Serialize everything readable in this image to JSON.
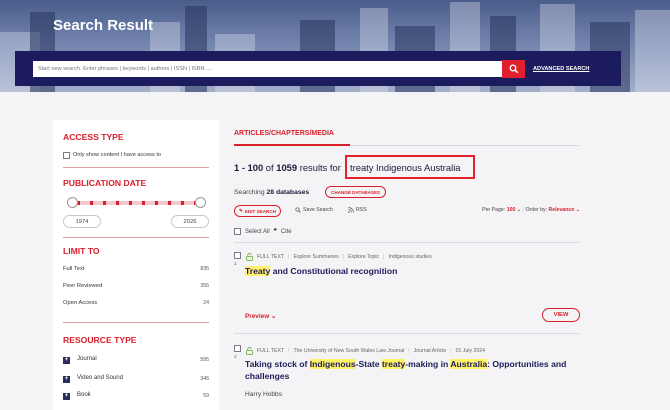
{
  "header": {
    "title": "Search Result",
    "search_placeholder": "Start new search. Enter phrases | keywords | authors | ISSN | ISBN ....",
    "advanced_search": "ADVANCED SEARCH"
  },
  "sidebar": {
    "access_type": {
      "title": "ACCESS TYPE",
      "checkbox_label": "Only show content I have access to"
    },
    "publication_date": {
      "title": "PUBLICATION DATE",
      "from_year": "1974",
      "to_year": "2026"
    },
    "limit_to": {
      "title": "LIMIT TO",
      "items": [
        {
          "label": "Full Text",
          "count": "835"
        },
        {
          "label": "Peer Reviewed",
          "count": "355"
        },
        {
          "label": "Open Access",
          "count": "24"
        }
      ]
    },
    "resource_type": {
      "title": "RESOURCE TYPE",
      "items": [
        {
          "label": "Journal",
          "count": "595"
        },
        {
          "label": "Video and Sound",
          "count": "346"
        },
        {
          "label": "Book",
          "count": "59"
        }
      ]
    }
  },
  "main": {
    "tab": "ARTICLES/CHAPTERS/MEDIA",
    "results_range": "1 - 100",
    "results_of": "of",
    "results_total": "1059",
    "results_for": "results for",
    "query": "treaty Indigenous Australia",
    "searching_label": "Searching",
    "databases_count": "28 databases",
    "change_databases": "CHANGE DATABASES",
    "edit_search": "EDIT SEARCH",
    "save_search": "Save Search",
    "rss": "RSS",
    "per_page_label": "Per Page:",
    "per_page_value": "100",
    "order_label": "Order by:",
    "order_value": "Relevance",
    "select_all": "Select All",
    "cite": "Cite",
    "results": [
      {
        "number": "1",
        "meta": [
          "FULL TEXT",
          "Explore Summaries",
          "Explore Topic",
          "Indigenous studies"
        ],
        "title_hl_1": "Treaty",
        "title_rest_1": " and Constitutional recognition",
        "preview": "Preview",
        "view": "VIEW"
      },
      {
        "number": "2",
        "meta": [
          "FULL TEXT",
          "The University of New South Wales Law Journal",
          "Journal Article",
          "01 July 2024"
        ],
        "title_p1": "Taking stock of ",
        "title_hl_1": "Indigenous",
        "title_p2": "-State ",
        "title_hl_2": "treaty",
        "title_p3": "-making in ",
        "title_hl_3": "Australia",
        "title_p4": ": Opportunities and challenges",
        "author": "Harry Hobbs"
      }
    ]
  },
  "colors": {
    "brand_red": "#d81f2a",
    "navy": "#1b1b5e",
    "highlight": "#fff26a"
  }
}
